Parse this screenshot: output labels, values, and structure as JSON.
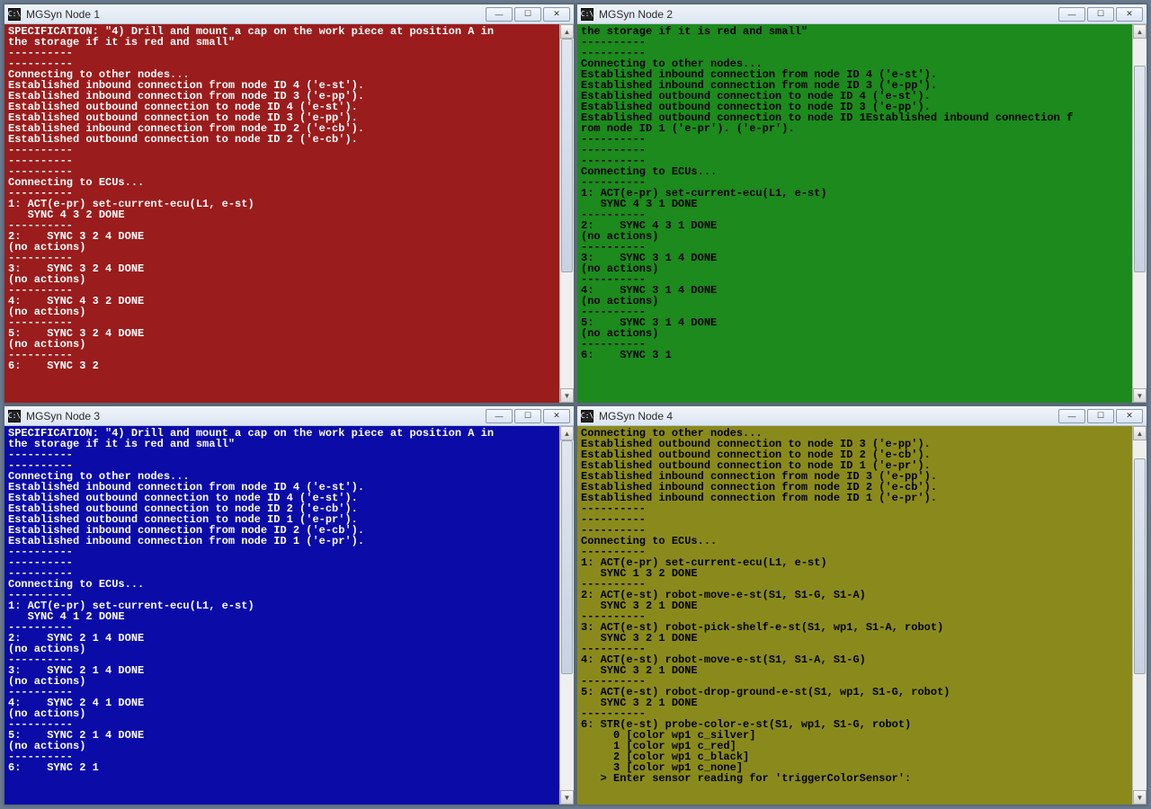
{
  "windows": [
    {
      "id": "node1",
      "title": "MGSyn Node 1",
      "termClass": "t1",
      "thumbTop": 0,
      "thumbHeight": 260,
      "lines": [
        "SPECIFICATION: \"4) Drill and mount a cap on the work piece at position A in",
        "the storage if it is red and small\"",
        "----------",
        "----------",
        "Connecting to other nodes...",
        "Established inbound connection from node ID 4 ('e-st').",
        "Established inbound connection from node ID 3 ('e-pp').",
        "Established outbound connection to node ID 4 ('e-st').",
        "Established outbound connection to node ID 3 ('e-pp').",
        "Established inbound connection from node ID 2 ('e-cb').",
        "Established outbound connection to node ID 2 ('e-cb').",
        "----------",
        "----------",
        "----------",
        "Connecting to ECUs...",
        "",
        "----------",
        "1: ACT(e-pr) set-current-ecu(L1, e-st)",
        "   SYNC 4 3 2 DONE",
        "----------",
        "2:    SYNC 3 2 4 DONE",
        "(no actions)",
        "----------",
        "3:    SYNC 3 2 4 DONE",
        "(no actions)",
        "----------",
        "4:    SYNC 4 3 2 DONE",
        "(no actions)",
        "----------",
        "5:    SYNC 3 2 4 DONE",
        "(no actions)",
        "----------",
        "6:    SYNC 3 2"
      ]
    },
    {
      "id": "node2",
      "title": "MGSyn Node 2",
      "termClass": "t2",
      "thumbTop": 30,
      "thumbHeight": 230,
      "lines": [
        "the storage if it is red and small\"",
        "----------",
        "----------",
        "Connecting to other nodes...",
        "Established inbound connection from node ID 4 ('e-st').",
        "Established inbound connection from node ID 3 ('e-pp').",
        "Established outbound connection to node ID 4 ('e-st').",
        "Established outbound connection to node ID 3 ('e-pp').",
        "Established outbound connection to node ID 1Established inbound connection f",
        "rom node ID 1 ('e-pr'). ('e-pr').",
        "----------",
        "----------",
        "----------",
        "Connecting to ECUs...",
        "",
        "----------",
        "1: ACT(e-pr) set-current-ecu(L1, e-st)",
        "   SYNC 4 3 1 DONE",
        "----------",
        "2:    SYNC 4 3 1 DONE",
        "(no actions)",
        "----------",
        "3:    SYNC 3 1 4 DONE",
        "(no actions)",
        "----------",
        "4:    SYNC 3 1 4 DONE",
        "(no actions)",
        "----------",
        "5:    SYNC 3 1 4 DONE",
        "(no actions)",
        "----------",
        "6:    SYNC 3 1"
      ]
    },
    {
      "id": "node3",
      "title": "MGSyn Node 3",
      "termClass": "t3",
      "thumbTop": 0,
      "thumbHeight": 260,
      "lines": [
        "SPECIFICATION: \"4) Drill and mount a cap on the work piece at position A in",
        "the storage if it is red and small\"",
        "----------",
        "----------",
        "Connecting to other nodes...",
        "Established inbound connection from node ID 4 ('e-st').",
        "Established outbound connection to node ID 4 ('e-st').",
        "Established outbound connection to node ID 2 ('e-cb').",
        "Established outbound connection to node ID 1 ('e-pr').",
        "Established inbound connection from node ID 2 ('e-cb').",
        "Established inbound connection from node ID 1 ('e-pr').",
        "----------",
        "----------",
        "----------",
        "Connecting to ECUs...",
        "",
        "----------",
        "1: ACT(e-pr) set-current-ecu(L1, e-st)",
        "   SYNC 4 1 2 DONE",
        "----------",
        "2:    SYNC 2 1 4 DONE",
        "(no actions)",
        "----------",
        "3:    SYNC 2 1 4 DONE",
        "(no actions)",
        "----------",
        "4:    SYNC 2 4 1 DONE",
        "(no actions)",
        "----------",
        "5:    SYNC 2 1 4 DONE",
        "(no actions)",
        "----------",
        "6:    SYNC 2 1"
      ]
    },
    {
      "id": "node4",
      "title": "MGSyn Node 4",
      "termClass": "t4",
      "thumbTop": 20,
      "thumbHeight": 240,
      "lines": [
        "Connecting to other nodes...",
        "Established outbound connection to node ID 3 ('e-pp').",
        "Established outbound connection to node ID 2 ('e-cb').",
        "Established outbound connection to node ID 1 ('e-pr').",
        "Established inbound connection from node ID 3 ('e-pp').",
        "Established inbound connection from node ID 2 ('e-cb').",
        "Established inbound connection from node ID 1 ('e-pr').",
        "----------",
        "----------",
        "----------",
        "Connecting to ECUs...",
        "",
        "----------",
        "1: ACT(e-pr) set-current-ecu(L1, e-st)",
        "   SYNC 1 3 2 DONE",
        "----------",
        "2: ACT(e-st) robot-move-e-st(S1, S1-G, S1-A)",
        "   SYNC 3 2 1 DONE",
        "----------",
        "3: ACT(e-st) robot-pick-shelf-e-st(S1, wp1, S1-A, robot)",
        "   SYNC 3 2 1 DONE",
        "----------",
        "4: ACT(e-st) robot-move-e-st(S1, S1-A, S1-G)",
        "   SYNC 3 2 1 DONE",
        "----------",
        "5: ACT(e-st) robot-drop-ground-e-st(S1, wp1, S1-G, robot)",
        "   SYNC 3 2 1 DONE",
        "----------",
        "6: STR(e-st) probe-color-e-st(S1, wp1, S1-G, robot)",
        "     0 [color wp1 c_silver]",
        "     1 [color wp1 c_red]",
        "     2 [color wp1 c_black]",
        "     3 [color wp1 c_none]",
        "   > Enter sensor reading for 'triggerColorSensor':"
      ]
    }
  ],
  "iconGlyph": "C:\\",
  "buttons": {
    "min": "—",
    "max": "☐",
    "close": "✕"
  }
}
